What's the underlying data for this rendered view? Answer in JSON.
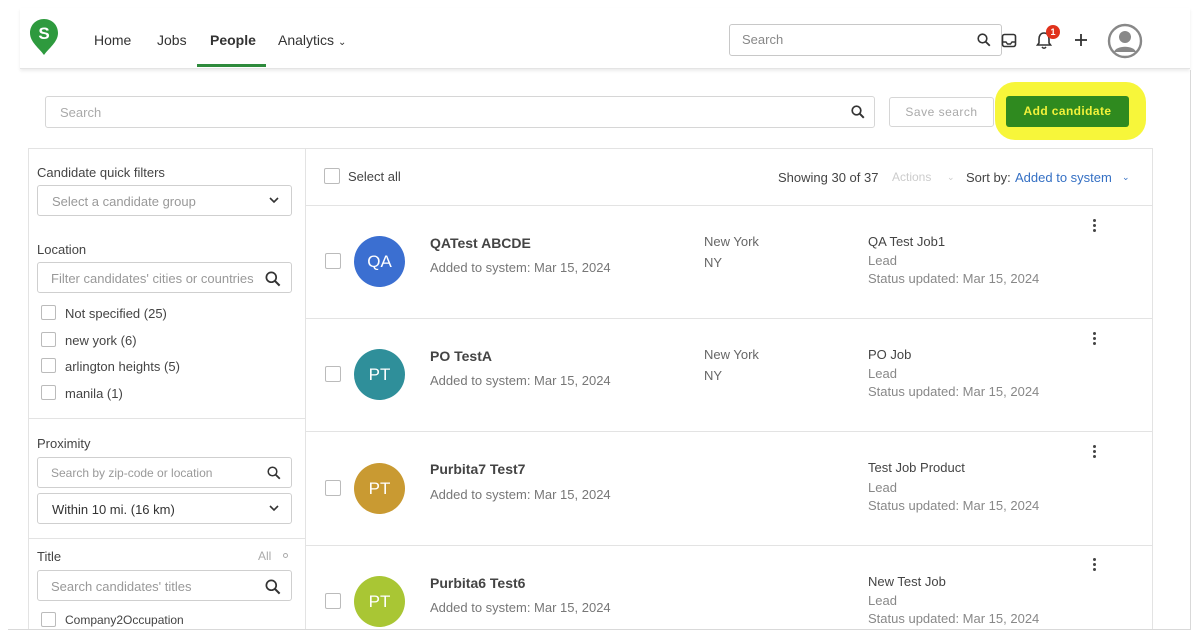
{
  "nav": {
    "logo_letter": "S",
    "links": [
      "Home",
      "Jobs",
      "People",
      "Analytics"
    ],
    "search_placeholder": "Search",
    "notification_count": "1"
  },
  "toolbar": {
    "search_placeholder": "Search",
    "save_search_label": "Save search",
    "add_candidate_label": "Add candidate"
  },
  "sidebar": {
    "quick_filters_title": "Candidate quick filters",
    "quick_filters_placeholder": "Select a candidate group",
    "location_title": "Location",
    "location_placeholder": "Filter candidates' cities or countries",
    "locations": [
      "Not specified (25)",
      "new york (6)",
      "arlington heights (5)",
      "manila (1)"
    ],
    "proximity_title": "Proximity",
    "proximity_placeholder": "Search by zip-code or location",
    "proximity_value": "Within 10 mi. (16 km)",
    "title_title": "Title",
    "title_all": "All",
    "title_placeholder": "Search candidates' titles",
    "title_first_option": "Company2Occupation"
  },
  "results": {
    "select_all": "Select all",
    "showing": "Showing 30 of 37",
    "actions": "Actions",
    "sort_label": "Sort by:",
    "sort_value": "Added to system",
    "candidates": [
      {
        "initials": "QA",
        "name": "QATest ABCDE",
        "added": "Added to system: Mar 15, 2024",
        "city": "New York",
        "state": "NY",
        "job": "QA Test Job1",
        "stage": "Lead",
        "status": "Status updated: Mar 15, 2024",
        "color": "#3b6fd1"
      },
      {
        "initials": "PT",
        "name": "PO TestA",
        "added": "Added to system: Mar 15, 2024",
        "city": "New York",
        "state": "NY",
        "job": "PO Job",
        "stage": "Lead",
        "status": "Status updated: Mar 15, 2024",
        "color": "#2f8f9a"
      },
      {
        "initials": "PT",
        "name": "Purbita7 Test7",
        "added": "Added to system: Mar 15, 2024",
        "city": "",
        "state": "",
        "job": "Test Job Product",
        "stage": "Lead",
        "status": "Status updated: Mar 15, 2024",
        "color": "#c99a32"
      },
      {
        "initials": "PT",
        "name": "Purbita6 Test6",
        "added": "Added to system: Mar 15, 2024",
        "city": "",
        "state": "",
        "job": "New Test Job",
        "stage": "Lead",
        "status": "Status updated: Mar 15, 2024",
        "color": "#a9c634"
      }
    ]
  },
  "colors": {
    "brand_green": "#2e8b3c",
    "button_green": "#2f8a1f",
    "highlight_yellow": "#f7f63a",
    "link_blue": "#3570c4"
  }
}
